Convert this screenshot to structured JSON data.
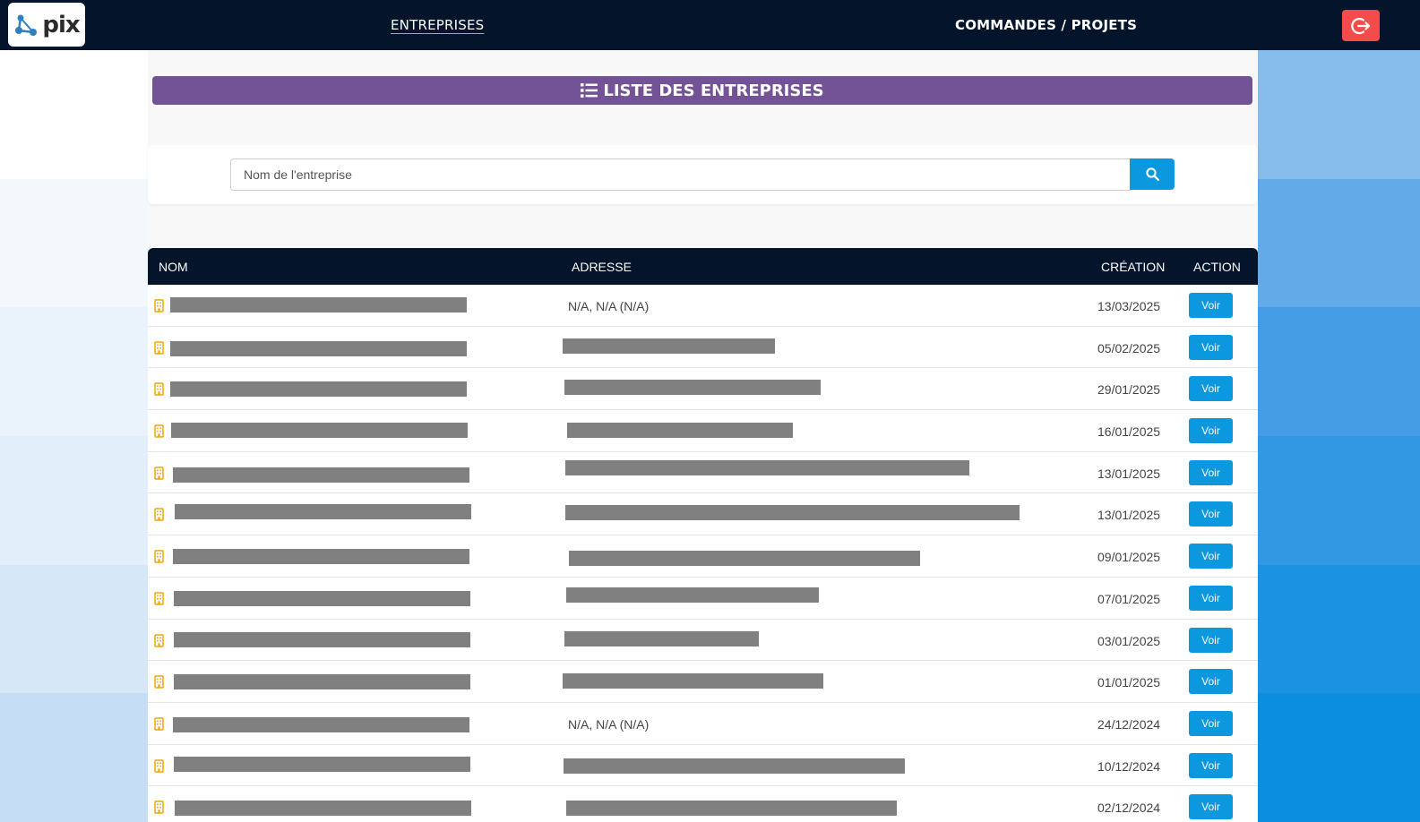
{
  "header": {
    "logo_text": "pix",
    "nav": [
      {
        "label": "ENTREPRISES",
        "active": true
      },
      {
        "label": "COMMANDES / PROJETS",
        "active": false
      }
    ],
    "logout_icon": "logout-icon"
  },
  "page": {
    "title": "LISTE DES ENTREPRISES",
    "title_icon": "list-icon"
  },
  "search": {
    "placeholder": "Nom de l'entreprise",
    "value": "",
    "button_icon": "search-icon"
  },
  "table": {
    "headers": {
      "nom": "NOM",
      "adresse": "ADRESSE",
      "creation": "CRÉATION",
      "action": "ACTION"
    },
    "rows": [
      {
        "nom": "[redacted]",
        "adresse": "N/A, N/A (N/A)",
        "creation": "13/03/2025",
        "action": "Voir"
      },
      {
        "nom": "[redacted]",
        "adresse": "[redacted]",
        "creation": "05/02/2025",
        "action": "Voir"
      },
      {
        "nom": "[redacted]",
        "adresse": "[redacted]",
        "creation": "29/01/2025",
        "action": "Voir"
      },
      {
        "nom": "[redacted]",
        "adresse": "[redacted]",
        "creation": "16/01/2025",
        "action": "Voir"
      },
      {
        "nom": "[redacted]",
        "adresse": "[redacted]",
        "creation": "13/01/2025",
        "action": "Voir"
      },
      {
        "nom": "[redacted]",
        "adresse": "[redacted]",
        "creation": "13/01/2025",
        "action": "Voir"
      },
      {
        "nom": "[redacted]",
        "adresse": "[redacted]",
        "creation": "09/01/2025",
        "action": "Voir"
      },
      {
        "nom": "[redacted]",
        "adresse": "[redacted]",
        "creation": "07/01/2025",
        "action": "Voir"
      },
      {
        "nom": "[redacted]",
        "adresse": "[redacted]",
        "creation": "03/01/2025",
        "action": "Voir"
      },
      {
        "nom": "[redacted]",
        "adresse": "[redacted]",
        "creation": "01/01/2025",
        "action": "Voir"
      },
      {
        "nom": "[redacted]",
        "adresse": "N/A, N/A (N/A)",
        "creation": "24/12/2024",
        "action": "Voir"
      },
      {
        "nom": "[redacted]",
        "adresse": "[redacted]",
        "creation": "10/12/2024",
        "action": "Voir"
      },
      {
        "nom": "[redacted]",
        "adresse": "[redacted]",
        "creation": "02/12/2024",
        "action": "Voir"
      }
    ]
  },
  "colors": {
    "topbar": "#03142b",
    "title_bar": "#735395",
    "primary_button": "#0b98de",
    "logout_button": "#f44b4b",
    "building_icon": "#f0a500",
    "nav_underline": "#f0a500"
  }
}
